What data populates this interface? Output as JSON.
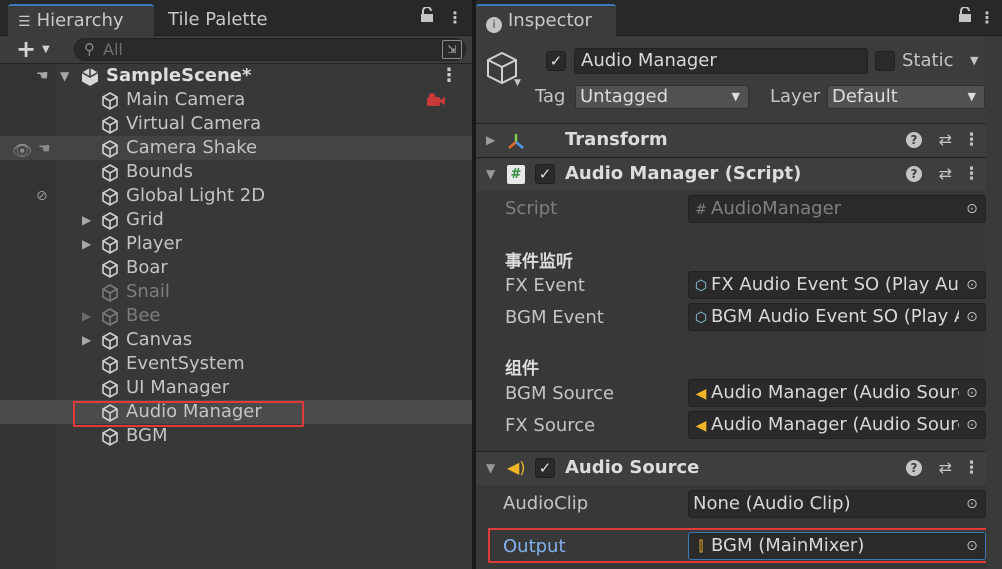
{
  "hierarchy": {
    "tabs": [
      {
        "label": "Hierarchy",
        "icon": "list-icon"
      },
      {
        "label": "Tile Palette"
      }
    ],
    "search_placeholder": "All",
    "scene": {
      "name": "SampleScene*"
    },
    "items": [
      {
        "label": "Main Camera",
        "expandable": false,
        "disabled": false
      },
      {
        "label": "Virtual Camera",
        "expandable": false,
        "disabled": false
      },
      {
        "label": "Camera Shake",
        "expandable": false,
        "disabled": false
      },
      {
        "label": "Bounds",
        "expandable": false,
        "disabled": false
      },
      {
        "label": "Global Light 2D",
        "expandable": false,
        "disabled": false
      },
      {
        "label": "Grid",
        "expandable": true,
        "disabled": false
      },
      {
        "label": "Player",
        "expandable": true,
        "disabled": false
      },
      {
        "label": "Boar",
        "expandable": false,
        "disabled": false
      },
      {
        "label": "Snail",
        "expandable": false,
        "disabled": true
      },
      {
        "label": "Bee",
        "expandable": true,
        "disabled": true
      },
      {
        "label": "Canvas",
        "expandable": true,
        "disabled": false
      },
      {
        "label": "EventSystem",
        "expandable": false,
        "disabled": false
      },
      {
        "label": "UI Manager",
        "expandable": false,
        "disabled": false
      },
      {
        "label": "Audio Manager",
        "expandable": false,
        "disabled": false,
        "selected": true
      },
      {
        "label": "BGM",
        "expandable": false,
        "disabled": false
      }
    ]
  },
  "inspector": {
    "tab": "Inspector",
    "object_name": "Audio Manager",
    "static_label": "Static",
    "tag_label": "Tag",
    "tag_value": "Untagged",
    "layer_label": "Layer",
    "layer_value": "Default",
    "components": {
      "transform": {
        "title": "Transform"
      },
      "script": {
        "title": "Audio Manager (Script)",
        "script_label": "Script",
        "script_value": "AudioManager",
        "section1": "事件监听",
        "fx_event_label": "FX Event",
        "fx_event_value": "FX Audio Event SO (Play Aud",
        "bgm_event_label": "BGM Event",
        "bgm_event_value": "BGM Audio Event SO (Play A",
        "section2": "组件",
        "bgm_source_label": "BGM Source",
        "bgm_source_value": "Audio Manager (Audio Sourc",
        "fx_source_label": "FX Source",
        "fx_source_value": "Audio Manager (Audio Sourc"
      },
      "audio_source": {
        "title": "Audio Source",
        "clip_label": "AudioClip",
        "clip_value": "None (Audio Clip)",
        "output_label": "Output",
        "output_value": "BGM (MainMixer)"
      }
    }
  },
  "colors": {
    "accent_blue": "#3a79bb",
    "highlight_red": "#e03a3a",
    "output_label_blue": "#7fb2ef",
    "selection": "#4b4b4b"
  }
}
